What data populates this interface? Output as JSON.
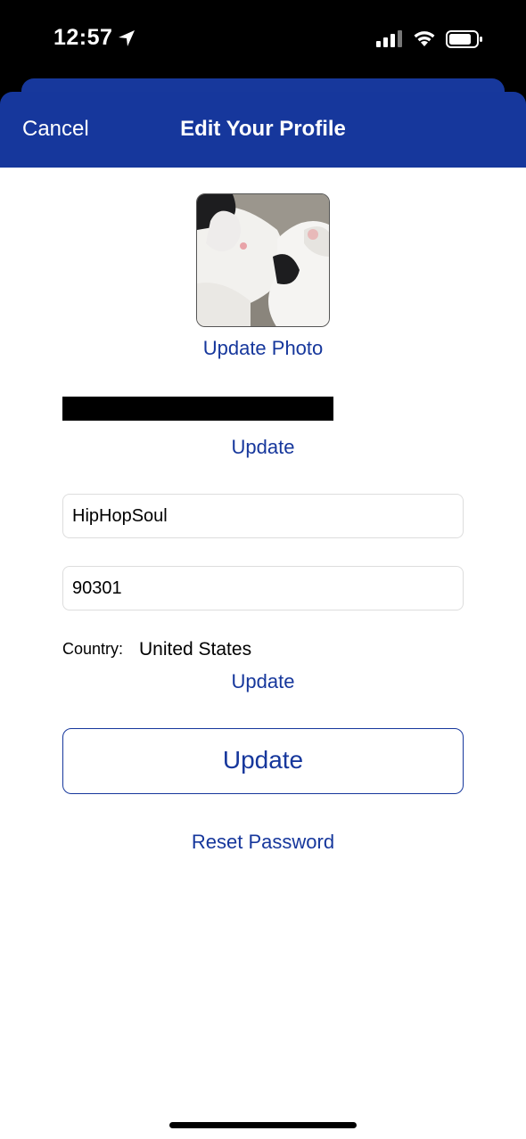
{
  "status": {
    "time": "12:57"
  },
  "nav": {
    "cancel_label": "Cancel",
    "title": "Edit Your Profile"
  },
  "profile": {
    "update_photo_label": "Update Photo",
    "update_name_label": "Update",
    "username": "HipHopSoul",
    "zip_code": "90301",
    "country_label": "Country:",
    "country_value": "United States",
    "update_country_label": "Update",
    "update_button_label": "Update",
    "reset_password_label": "Reset Password"
  },
  "colors": {
    "brand_blue": "#16379c",
    "field_border": "#dddddd"
  }
}
